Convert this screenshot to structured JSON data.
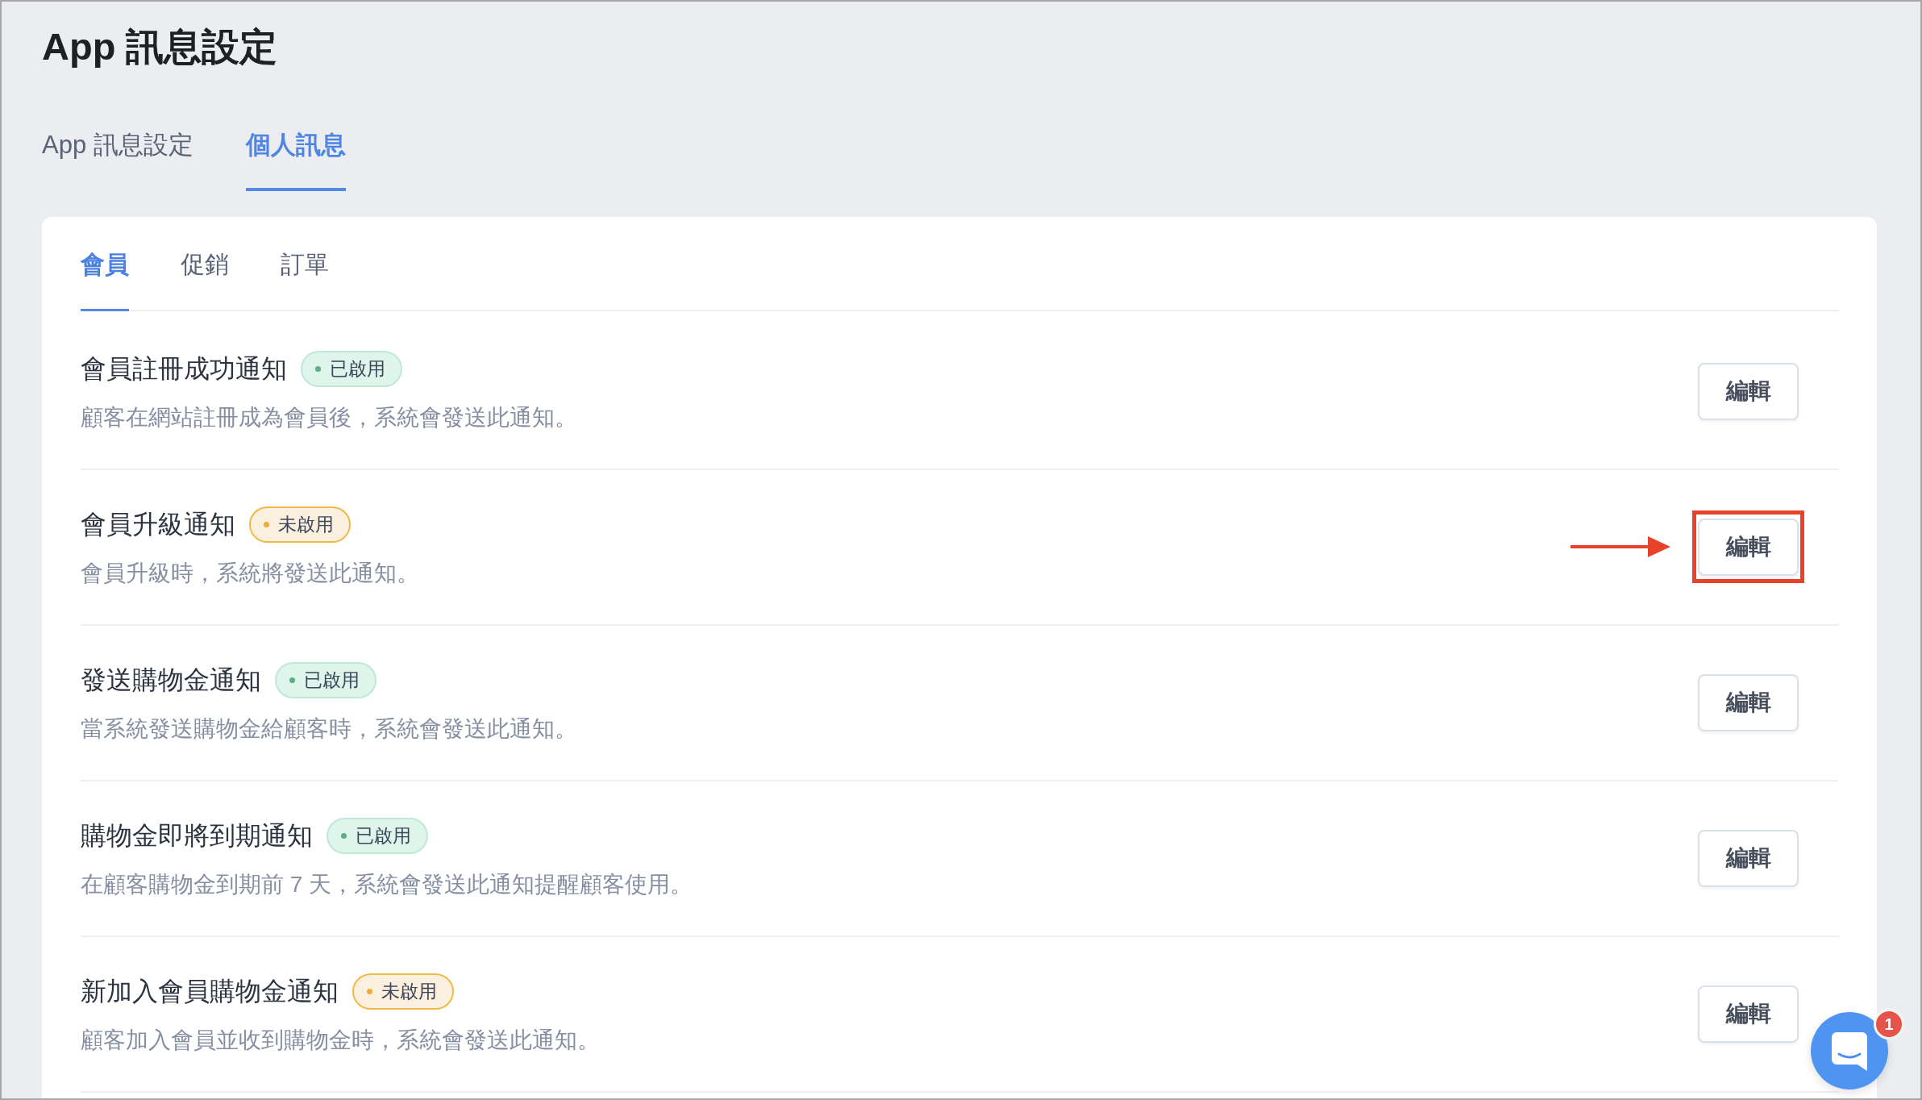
{
  "page": {
    "title": "App 訊息設定"
  },
  "tabs": [
    {
      "label": "App 訊息設定",
      "selected": false
    },
    {
      "label": "個人訊息",
      "selected": true
    }
  ],
  "panel": {
    "tabs": [
      {
        "label": "會員",
        "selected": true
      },
      {
        "label": "促銷",
        "selected": false
      },
      {
        "label": "訂單",
        "selected": false
      }
    ],
    "notifications": [
      {
        "title": "會員註冊成功通知",
        "status": {
          "label": "已啟用",
          "enabled": true
        },
        "description": "顧客在網站註冊成為會員後，系統會發送此通知。",
        "button": "編輯",
        "highlighted": false
      },
      {
        "title": "會員升級通知",
        "status": {
          "label": "未啟用",
          "enabled": false
        },
        "description": "會員升級時，系統將發送此通知。",
        "button": "編輯",
        "highlighted": true
      },
      {
        "title": "發送購物金通知",
        "status": {
          "label": "已啟用",
          "enabled": true
        },
        "description": "當系統發送購物金給顧客時，系統會發送此通知。",
        "button": "編輯",
        "highlighted": false
      },
      {
        "title": "購物金即將到期通知",
        "status": {
          "label": "已啟用",
          "enabled": true
        },
        "description": "在顧客購物金到期前 7 天，系統會發送此通知提醒顧客使用。",
        "button": "編輯",
        "highlighted": false
      },
      {
        "title": "新加入會員購物金通知",
        "status": {
          "label": "未啟用",
          "enabled": false
        },
        "description": "顧客加入會員並收到購物金時，系統會發送此通知。",
        "button": "編輯",
        "highlighted": false
      }
    ]
  },
  "chat": {
    "unread": "1"
  }
}
